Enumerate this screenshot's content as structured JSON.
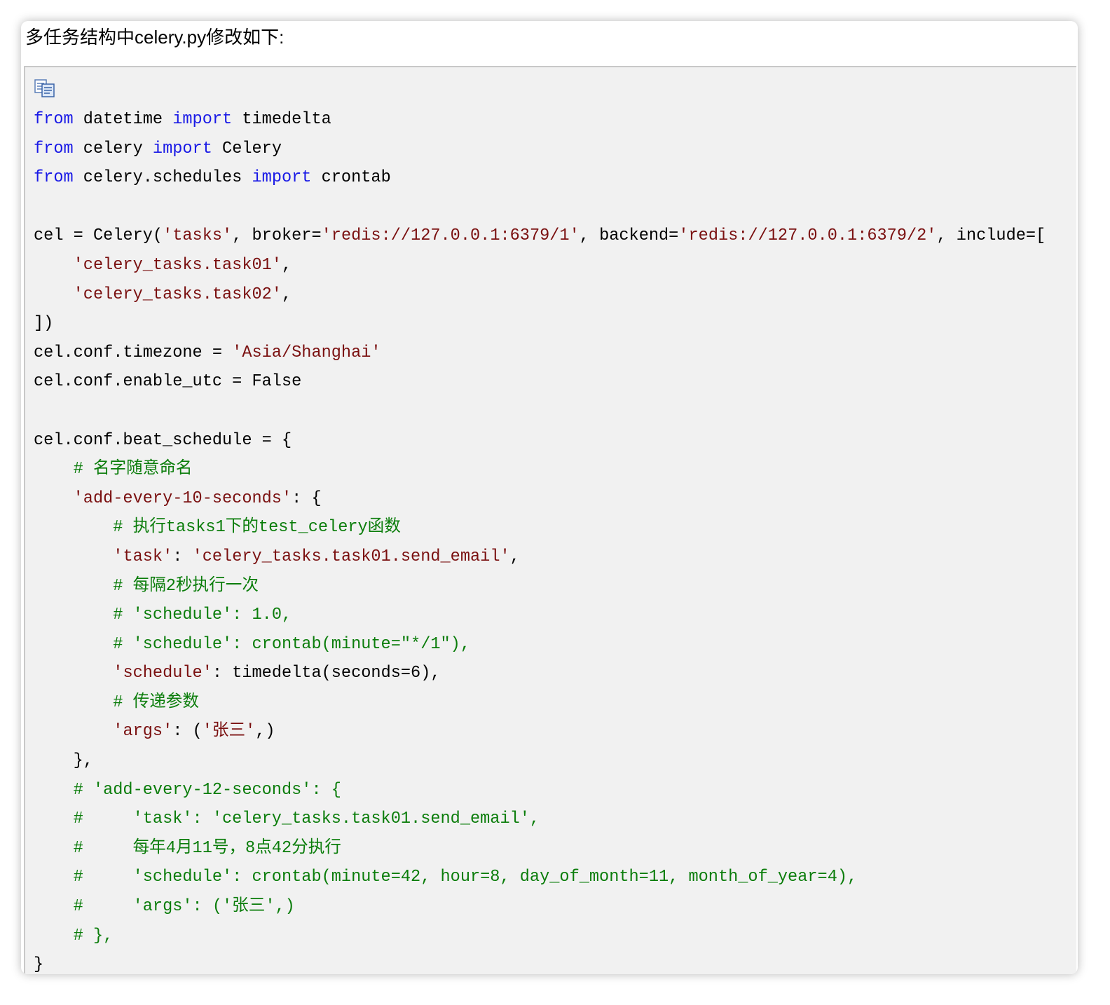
{
  "heading": "多任务结构中celery.py修改如下:",
  "copy_icon": "copy-code-icon",
  "colors": {
    "keyword": "#1a1ae6",
    "string": "#7a1010",
    "comment": "#0b7d0b",
    "code_background": "#f1f1f1"
  },
  "code_lines": [
    [
      {
        "t": "kw",
        "v": "from"
      },
      {
        "t": "n",
        "v": " datetime "
      },
      {
        "t": "kw",
        "v": "import"
      },
      {
        "t": "n",
        "v": " timedelta"
      }
    ],
    [
      {
        "t": "kw",
        "v": "from"
      },
      {
        "t": "n",
        "v": " celery "
      },
      {
        "t": "kw",
        "v": "import"
      },
      {
        "t": "n",
        "v": " Celery"
      }
    ],
    [
      {
        "t": "kw",
        "v": "from"
      },
      {
        "t": "n",
        "v": " celery.schedules "
      },
      {
        "t": "kw",
        "v": "import"
      },
      {
        "t": "n",
        "v": " crontab"
      }
    ],
    [],
    [
      {
        "t": "n",
        "v": "cel = Celery("
      },
      {
        "t": "str",
        "v": "'tasks'"
      },
      {
        "t": "n",
        "v": ", broker="
      },
      {
        "t": "str",
        "v": "'redis://127.0.0.1:6379/1'"
      },
      {
        "t": "n",
        "v": ", backend="
      },
      {
        "t": "str",
        "v": "'redis://127.0.0.1:6379/2'"
      },
      {
        "t": "n",
        "v": ", include=["
      }
    ],
    [
      {
        "t": "n",
        "v": "    "
      },
      {
        "t": "str",
        "v": "'celery_tasks.task01'"
      },
      {
        "t": "n",
        "v": ","
      }
    ],
    [
      {
        "t": "n",
        "v": "    "
      },
      {
        "t": "str",
        "v": "'celery_tasks.task02'"
      },
      {
        "t": "n",
        "v": ","
      }
    ],
    [
      {
        "t": "n",
        "v": "])"
      }
    ],
    [
      {
        "t": "n",
        "v": "cel.conf.timezone = "
      },
      {
        "t": "str",
        "v": "'Asia/Shanghai'"
      }
    ],
    [
      {
        "t": "n",
        "v": "cel.conf.enable_utc = False"
      }
    ],
    [],
    [
      {
        "t": "n",
        "v": "cel.conf.beat_schedule = {"
      }
    ],
    [
      {
        "t": "n",
        "v": "    "
      },
      {
        "t": "cm",
        "v": "# 名字随意命名"
      }
    ],
    [
      {
        "t": "n",
        "v": "    "
      },
      {
        "t": "str",
        "v": "'add-every-10-seconds'"
      },
      {
        "t": "n",
        "v": ": {"
      }
    ],
    [
      {
        "t": "n",
        "v": "        "
      },
      {
        "t": "cm",
        "v": "# 执行tasks1下的test_celery函数"
      }
    ],
    [
      {
        "t": "n",
        "v": "        "
      },
      {
        "t": "str",
        "v": "'task'"
      },
      {
        "t": "n",
        "v": ": "
      },
      {
        "t": "str",
        "v": "'celery_tasks.task01.send_email'"
      },
      {
        "t": "n",
        "v": ","
      }
    ],
    [
      {
        "t": "n",
        "v": "        "
      },
      {
        "t": "cm",
        "v": "# 每隔2秒执行一次"
      }
    ],
    [
      {
        "t": "n",
        "v": "        "
      },
      {
        "t": "cm",
        "v": "# 'schedule': 1.0,"
      }
    ],
    [
      {
        "t": "n",
        "v": "        "
      },
      {
        "t": "cm",
        "v": "# 'schedule': crontab(minute=\"*/1\"),"
      }
    ],
    [
      {
        "t": "n",
        "v": "        "
      },
      {
        "t": "str",
        "v": "'schedule'"
      },
      {
        "t": "n",
        "v": ": timedelta(seconds=6),"
      }
    ],
    [
      {
        "t": "n",
        "v": "        "
      },
      {
        "t": "cm",
        "v": "# 传递参数"
      }
    ],
    [
      {
        "t": "n",
        "v": "        "
      },
      {
        "t": "str",
        "v": "'args'"
      },
      {
        "t": "n",
        "v": ": ("
      },
      {
        "t": "str",
        "v": "'张三'"
      },
      {
        "t": "n",
        "v": ",)"
      }
    ],
    [
      {
        "t": "n",
        "v": "    },"
      }
    ],
    [
      {
        "t": "n",
        "v": "    "
      },
      {
        "t": "cm",
        "v": "# 'add-every-12-seconds': {"
      }
    ],
    [
      {
        "t": "n",
        "v": "    "
      },
      {
        "t": "cm",
        "v": "#     'task': 'celery_tasks.task01.send_email',"
      }
    ],
    [
      {
        "t": "n",
        "v": "    "
      },
      {
        "t": "cm",
        "v": "#     每年4月11号，8点42分执行"
      }
    ],
    [
      {
        "t": "n",
        "v": "    "
      },
      {
        "t": "cm",
        "v": "#     'schedule': crontab(minute=42, hour=8, day_of_month=11, month_of_year=4),"
      }
    ],
    [
      {
        "t": "n",
        "v": "    "
      },
      {
        "t": "cm",
        "v": "#     'args': ('张三',)"
      }
    ],
    [
      {
        "t": "n",
        "v": "    "
      },
      {
        "t": "cm",
        "v": "# },"
      }
    ],
    [
      {
        "t": "n",
        "v": "}"
      }
    ]
  ]
}
